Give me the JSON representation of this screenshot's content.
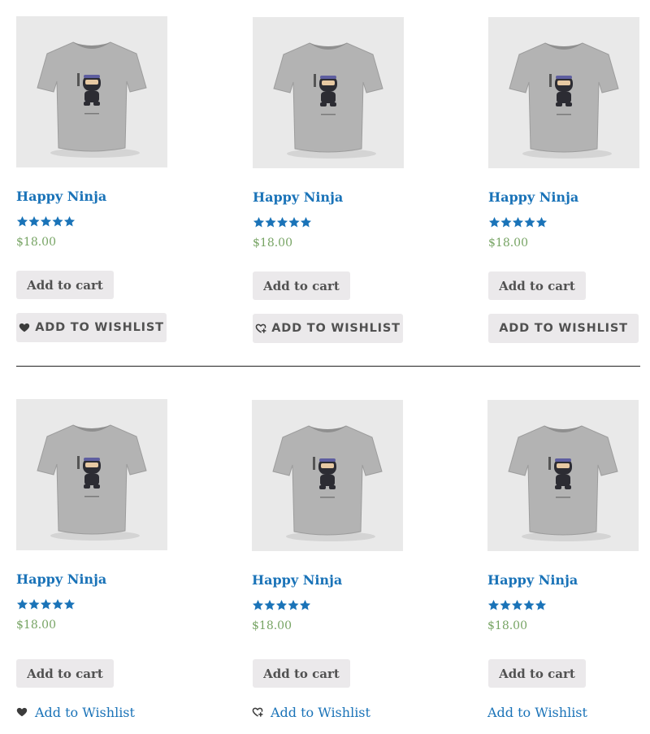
{
  "colors": {
    "link": "#1a73b8",
    "price": "#77a464",
    "button_bg": "#ebe9eb",
    "button_text": "#515151",
    "stars": "#1a73b8"
  },
  "products": [
    {
      "name": "Happy Ninja",
      "price": "$18.00",
      "rating": 5,
      "cart_label": "Add to cart",
      "wishlist_label": "ADD TO WISHLIST",
      "wishlist_icon": "heart-icon",
      "wishlist_style": "button"
    },
    {
      "name": "Happy Ninja",
      "price": "$18.00",
      "rating": 5,
      "cart_label": "Add to cart",
      "wishlist_label": "ADD TO WISHLIST",
      "wishlist_icon": "heart-plus-icon",
      "wishlist_style": "button"
    },
    {
      "name": "Happy Ninja",
      "price": "$18.00",
      "rating": 5,
      "cart_label": "Add to cart",
      "wishlist_label": "ADD TO WISHLIST",
      "wishlist_icon": "none",
      "wishlist_style": "button"
    },
    {
      "name": "Happy Ninja",
      "price": "$18.00",
      "rating": 5,
      "cart_label": "Add to cart",
      "wishlist_label": "Add to Wishlist",
      "wishlist_icon": "heart-icon",
      "wishlist_style": "link"
    },
    {
      "name": "Happy Ninja",
      "price": "$18.00",
      "rating": 5,
      "cart_label": "Add to cart",
      "wishlist_label": "Add to Wishlist",
      "wishlist_icon": "heart-plus-icon",
      "wishlist_style": "link"
    },
    {
      "name": "Happy Ninja",
      "price": "$18.00",
      "rating": 5,
      "cart_label": "Add to cart",
      "wishlist_label": "Add to Wishlist",
      "wishlist_icon": "none",
      "wishlist_style": "link"
    }
  ]
}
